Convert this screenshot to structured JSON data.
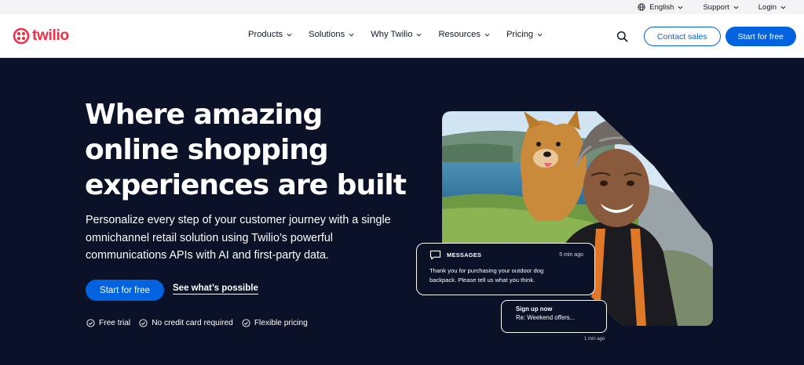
{
  "utility": {
    "language": "English",
    "support": "Support",
    "login": "Login"
  },
  "nav": {
    "logo_text": "twilio",
    "links": [
      "Products",
      "Solutions",
      "Why Twilio",
      "Resources",
      "Pricing"
    ],
    "contact_sales": "Contact sales",
    "start_free": "Start for free"
  },
  "hero": {
    "headline_lines": [
      "Where amazing",
      "online shopping",
      "experiences are built"
    ],
    "subhead_lines": [
      "Personalize every step of your customer journey with a single",
      "omnichannel retail solution using Twilio’s powerful",
      "communications APIs with AI and first-party data."
    ],
    "cta_primary": "Start for free",
    "cta_secondary": "See what’s possible",
    "perks": [
      "Free trial",
      "No credit card required",
      "Flexible pricing"
    ]
  },
  "message_card": {
    "label": "MESSAGES",
    "time": "5 min ago",
    "body_lines": [
      "Thank you for purchasing your outdoor dog",
      "backpack. Please tell us what you think."
    ]
  },
  "signup_card": {
    "title": "Sign up now",
    "body": "Re: Weekend offers...",
    "time": "1 min ago"
  },
  "colors": {
    "brand_red": "#f22f46",
    "primary_blue": "#0263e0",
    "hero_bg": "#0b1127",
    "utility_bg": "#f4f4f6"
  },
  "icons": {
    "language": "globe-icon",
    "search": "search-icon",
    "perk": "check-circle-icon",
    "messages": "chat-bubble-icon",
    "dropdown": "chevron-down-icon"
  }
}
